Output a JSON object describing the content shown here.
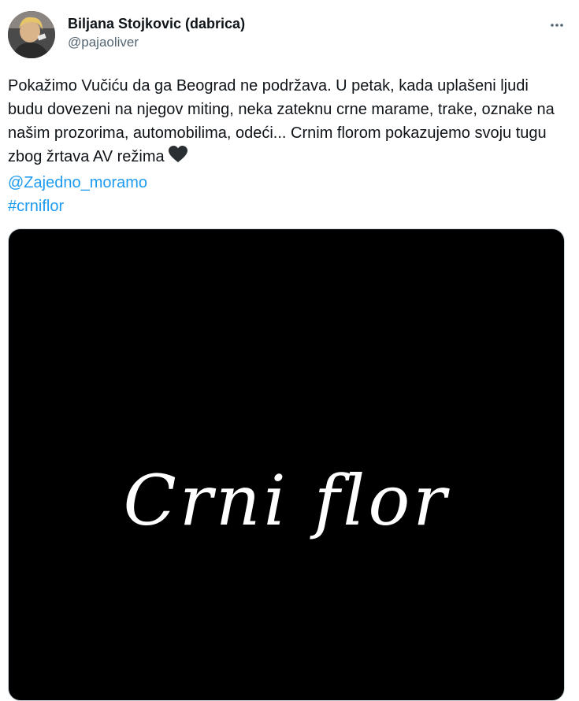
{
  "author": {
    "display_name": "Biljana Stojkovic (dabrica)",
    "handle": "@pajaoliver"
  },
  "tweet": {
    "body": "Pokažimo Vučiću da ga Beograd ne podržava. U petak, kada uplašeni ljudi budu dovezeni na njegov miting, neka zateknu crne marame, trake, oznake na našim prozorima, automobilima, odeći... Crnim florom pokazujemo svoju tugu zbog žrtava AV režima",
    "emoji": "black-heart",
    "mention": "@Zajedno_moramo",
    "hashtag": "#crniflor"
  },
  "media": {
    "caption": "Crni flor",
    "background_color": "#000000"
  },
  "colors": {
    "link": "#1d9bf0",
    "text": "#0f1419",
    "secondary": "#536471"
  },
  "icons": {
    "more": "more-horizontal-icon",
    "heart": "black-heart-icon"
  }
}
